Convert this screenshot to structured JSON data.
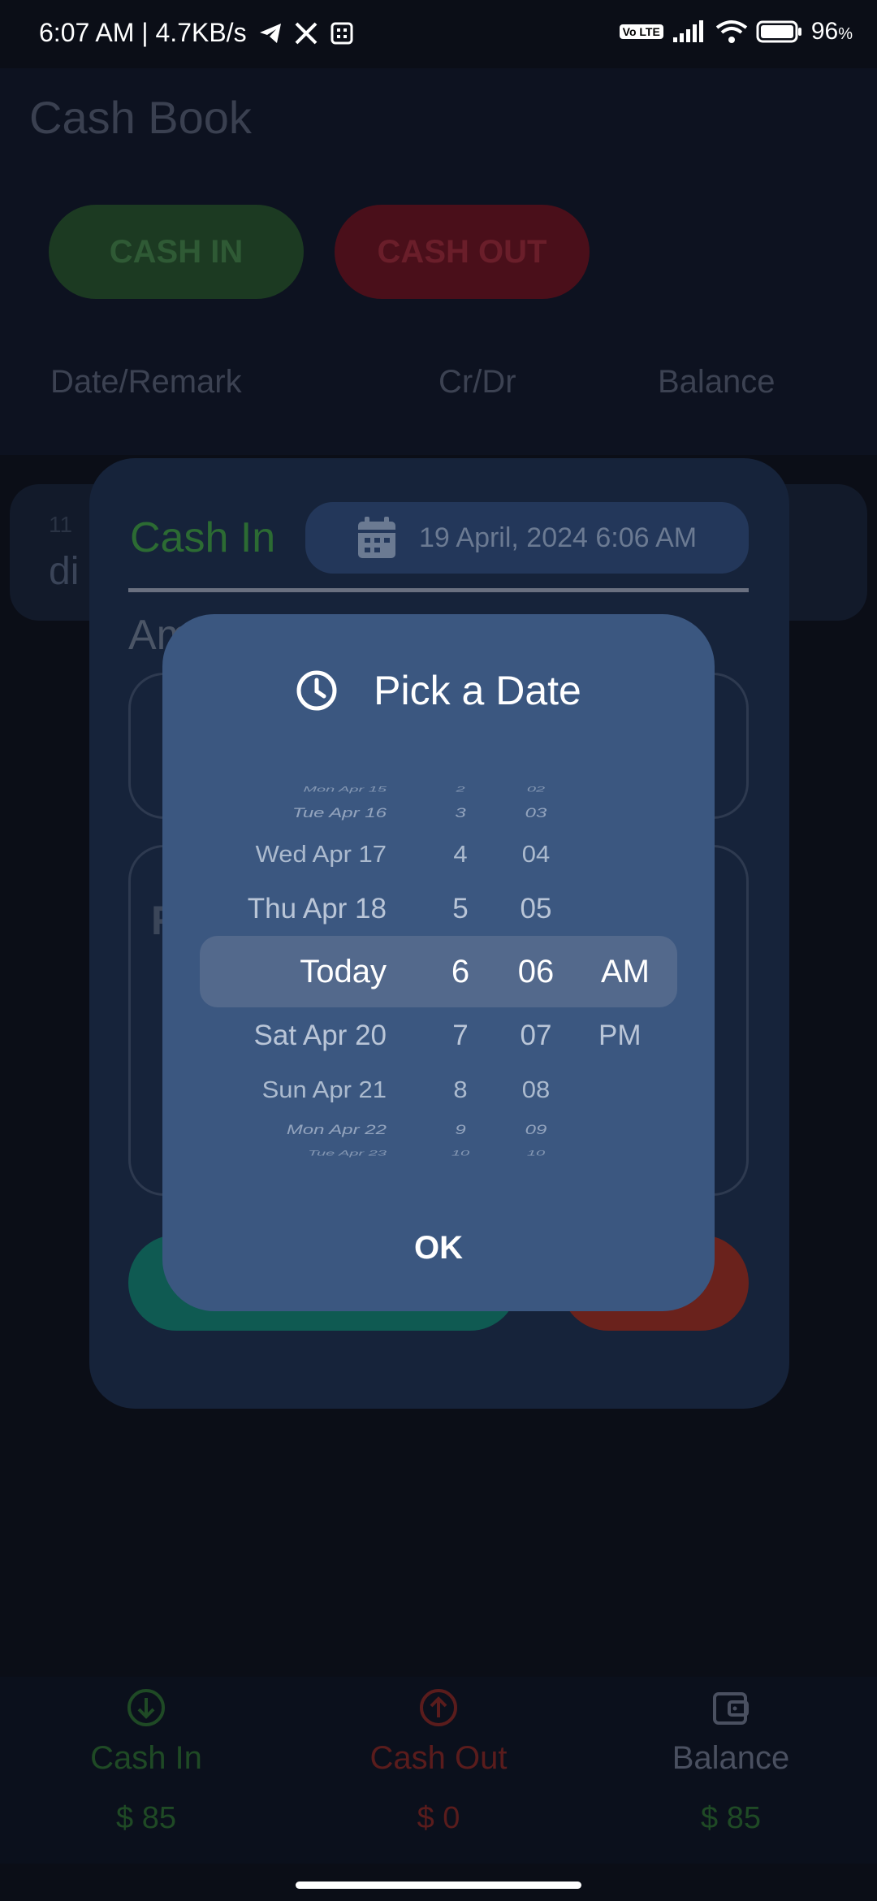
{
  "status_bar": {
    "time_speed": "6:07 AM | 4.7KB/s",
    "volte": "Vo LTE",
    "battery": "96"
  },
  "app": {
    "title": "Cash Book",
    "cash_in_button": "CASH IN",
    "cash_out_button": "CASH OUT",
    "columns": [
      "Date/Remark",
      "Cr/Dr",
      "Balance"
    ],
    "row_small": "11",
    "row_big": "di"
  },
  "entry_dialog": {
    "title": "Cash In",
    "date_value": "19 April, 2024 6:06 AM",
    "amount_label": "Am",
    "remark_label": "R"
  },
  "picker": {
    "title": "Pick a Date",
    "dates": [
      "Mon Apr 15",
      "Tue Apr 16",
      "Wed Apr 17",
      "Thu Apr 18",
      "Today",
      "Sat Apr 20",
      "Sun Apr 21",
      "Mon Apr 22",
      "Tue Apr 23"
    ],
    "hours": [
      "2",
      "3",
      "4",
      "5",
      "6",
      "7",
      "8",
      "9",
      "10"
    ],
    "minutes": [
      "02",
      "03",
      "04",
      "05",
      "06",
      "07",
      "08",
      "09",
      "10"
    ],
    "ampm": [
      "AM",
      "PM"
    ],
    "ok_label": "OK"
  },
  "bottom_nav": {
    "items": [
      {
        "label": "Cash In",
        "value": "$ 85",
        "icon": "arrow-down-circle-icon",
        "color": "#1f4a25"
      },
      {
        "label": "Cash Out",
        "value": "$ 0",
        "icon": "arrow-up-circle-icon",
        "color": "#5a1c1c"
      },
      {
        "label": "Balance",
        "value": "$ 85",
        "icon": "wallet-icon",
        "color": "#4a5060"
      }
    ],
    "value_color": "#1f4a25",
    "cash_out_value_color": "#5a1c1c"
  }
}
